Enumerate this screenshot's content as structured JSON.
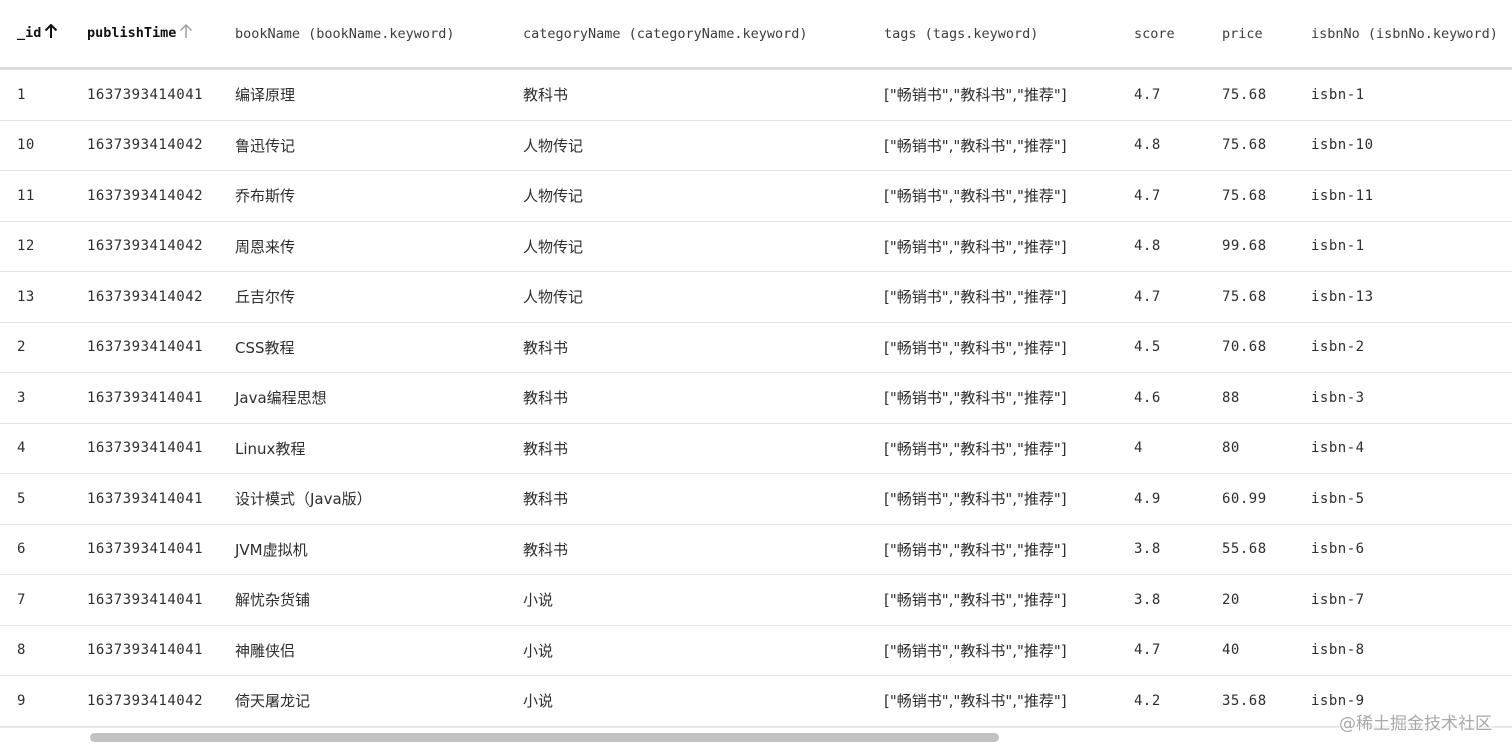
{
  "table": {
    "columns": [
      {
        "key": "id",
        "label": "_id",
        "sort": "asc-active"
      },
      {
        "key": "publishTime",
        "label": "publishTime",
        "sort": "asc-inactive"
      },
      {
        "key": "bookName",
        "label": "bookName (bookName.keyword)"
      },
      {
        "key": "categoryName",
        "label": "categoryName (categoryName.keyword)"
      },
      {
        "key": "tags",
        "label": "tags (tags.keyword)"
      },
      {
        "key": "score",
        "label": "score"
      },
      {
        "key": "price",
        "label": "price"
      },
      {
        "key": "isbnNo",
        "label": "isbnNo (isbnNo.keyword)"
      }
    ],
    "rows": [
      {
        "id": "1",
        "publishTime": "1637393414041",
        "bookName": "编译原理",
        "categoryName": "教科书",
        "tags": "[\"畅销书\",\"教科书\",\"推荐\"]",
        "score": "4.7",
        "price": "75.68",
        "isbnNo": "isbn-1"
      },
      {
        "id": "10",
        "publishTime": "1637393414042",
        "bookName": "鲁迅传记",
        "categoryName": "人物传记",
        "tags": "[\"畅销书\",\"教科书\",\"推荐\"]",
        "score": "4.8",
        "price": "75.68",
        "isbnNo": "isbn-10"
      },
      {
        "id": "11",
        "publishTime": "1637393414042",
        "bookName": "乔布斯传",
        "categoryName": "人物传记",
        "tags": "[\"畅销书\",\"教科书\",\"推荐\"]",
        "score": "4.7",
        "price": "75.68",
        "isbnNo": "isbn-11"
      },
      {
        "id": "12",
        "publishTime": "1637393414042",
        "bookName": "周恩来传",
        "categoryName": "人物传记",
        "tags": "[\"畅销书\",\"教科书\",\"推荐\"]",
        "score": "4.8",
        "price": "99.68",
        "isbnNo": "isbn-1"
      },
      {
        "id": "13",
        "publishTime": "1637393414042",
        "bookName": "丘吉尔传",
        "categoryName": "人物传记",
        "tags": "[\"畅销书\",\"教科书\",\"推荐\"]",
        "score": "4.7",
        "price": "75.68",
        "isbnNo": "isbn-13"
      },
      {
        "id": "2",
        "publishTime": "1637393414041",
        "bookName": "CSS教程",
        "categoryName": "教科书",
        "tags": "[\"畅销书\",\"教科书\",\"推荐\"]",
        "score": "4.5",
        "price": "70.68",
        "isbnNo": "isbn-2"
      },
      {
        "id": "3",
        "publishTime": "1637393414041",
        "bookName": "Java编程思想",
        "categoryName": "教科书",
        "tags": "[\"畅销书\",\"教科书\",\"推荐\"]",
        "score": "4.6",
        "price": "88",
        "isbnNo": "isbn-3"
      },
      {
        "id": "4",
        "publishTime": "1637393414041",
        "bookName": "Linux教程",
        "categoryName": "教科书",
        "tags": "[\"畅销书\",\"教科书\",\"推荐\"]",
        "score": "4",
        "price": "80",
        "isbnNo": "isbn-4"
      },
      {
        "id": "5",
        "publishTime": "1637393414041",
        "bookName": "设计模式（Java版）",
        "categoryName": "教科书",
        "tags": "[\"畅销书\",\"教科书\",\"推荐\"]",
        "score": "4.9",
        "price": "60.99",
        "isbnNo": "isbn-5"
      },
      {
        "id": "6",
        "publishTime": "1637393414041",
        "bookName": "JVM虚拟机",
        "categoryName": "教科书",
        "tags": "[\"畅销书\",\"教科书\",\"推荐\"]",
        "score": "3.8",
        "price": "55.68",
        "isbnNo": "isbn-6"
      },
      {
        "id": "7",
        "publishTime": "1637393414041",
        "bookName": "解忧杂货铺",
        "categoryName": "小说",
        "tags": "[\"畅销书\",\"教科书\",\"推荐\"]",
        "score": "3.8",
        "price": "20",
        "isbnNo": "isbn-7"
      },
      {
        "id": "8",
        "publishTime": "1637393414041",
        "bookName": "神雕侠侣",
        "categoryName": "小说",
        "tags": "[\"畅销书\",\"教科书\",\"推荐\"]",
        "score": "4.7",
        "price": "40",
        "isbnNo": "isbn-8"
      },
      {
        "id": "9",
        "publishTime": "1637393414042",
        "bookName": "倚天屠龙记",
        "categoryName": "小说",
        "tags": "[\"畅销书\",\"教科书\",\"推荐\"]",
        "score": "4.2",
        "price": "35.68",
        "isbnNo": "isbn-9"
      }
    ]
  },
  "icons": {
    "sort_active": "arrow-up-icon",
    "sort_inactive": "arrow-up-icon"
  },
  "colors": {
    "sort_active": "#111111",
    "sort_inactive": "#9a9a9a",
    "scroll_thumb": "#c2c2c2"
  },
  "watermark": "@稀土掘金技术社区"
}
